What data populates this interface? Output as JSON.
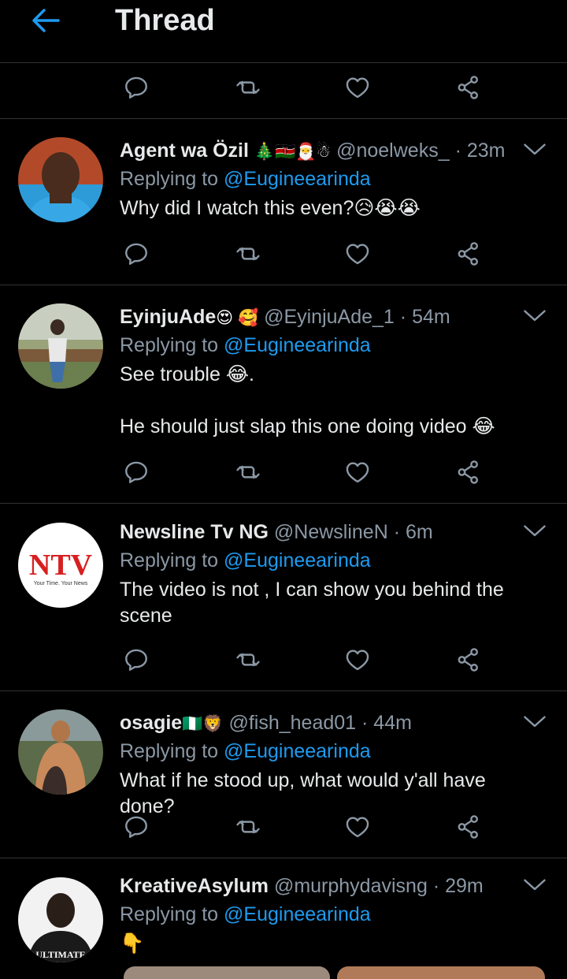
{
  "header": {
    "title": "Thread",
    "back_icon": "arrow-left-icon",
    "accent": "#1d9bf0"
  },
  "colors": {
    "background": "#000000",
    "text": "#e7e9ea",
    "secondary": "#8b98a5",
    "mention": "#1d9bf0",
    "divider": "#2f3336"
  },
  "action_icons": [
    "reply-icon",
    "retweet-icon",
    "like-icon",
    "share-icon"
  ],
  "tweets": [
    {
      "name": "Agent wa Özil",
      "name_emoji": "🎄🇰🇪🎅☃",
      "handle": "@noelweks_",
      "time": "· 23m",
      "replying_prefix": "Replying to ",
      "replying_to": "@Eugineearinda",
      "lines": [
        "Why did I watch this even?😥😭😭"
      ]
    },
    {
      "name": "EyinjuAde",
      "name_emoji": "😍 🥰",
      "handle": "@EyinjuAde_1",
      "time": "· 54m",
      "replying_prefix": "Replying to ",
      "replying_to": "@Eugineearinda",
      "lines": [
        "See trouble 😂.",
        "He should just slap this one doing video 😂"
      ]
    },
    {
      "name": "Newsline Tv NG",
      "name_emoji": "",
      "handle": "@NewslineN",
      "time": "· 6m",
      "replying_prefix": "Replying to ",
      "replying_to": "@Eugineearinda",
      "lines": [
        "The video is not , I can show you behind the scene"
      ],
      "avatar_text": {
        "logo": "NTV",
        "tagline": "Your Time. Your News"
      }
    },
    {
      "name": "osagie",
      "name_emoji": "🇳🇬🦁",
      "handle": "@fish_head01",
      "time": "· 44m",
      "replying_prefix": "Replying to ",
      "replying_to": "@Eugineearinda",
      "lines": [
        "What if he stood up, what would y'all have done?"
      ]
    },
    {
      "name": "KreativeAsylum",
      "name_emoji": "",
      "handle": "@murphydavisng",
      "time": "· 29m",
      "replying_prefix": "Replying to ",
      "replying_to": "@Eugineearinda",
      "lines": [
        "👇"
      ],
      "avatar_text": {
        "shirt": "ULTIMATE"
      }
    }
  ]
}
